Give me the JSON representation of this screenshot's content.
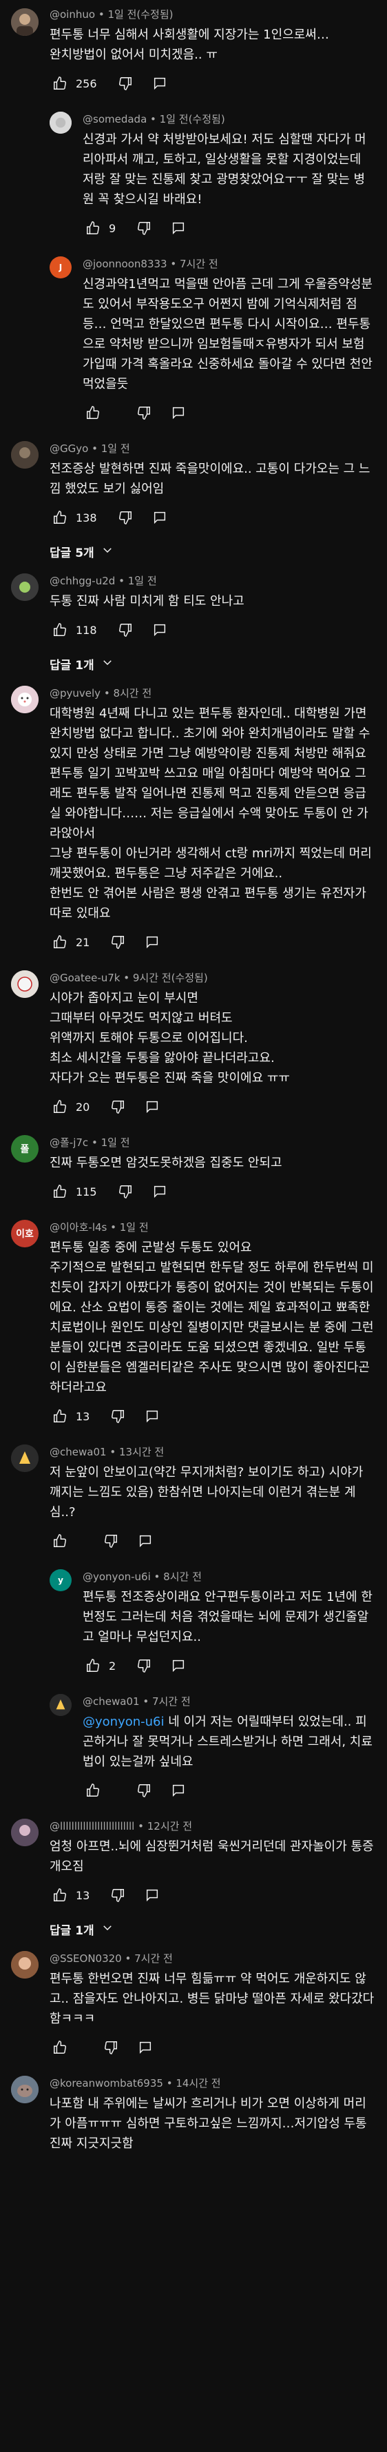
{
  "comments": [
    {
      "author": "@oinhuo",
      "time": "1일 전(수정됨)",
      "text": "편두통 너무 심해서 사회생활에 지장가는 1인으로써…\n완치방법이 없어서 미치겠음.. ㅠ",
      "likes": "256",
      "avatar": {
        "letter": "",
        "color": "#6b5b4f"
      }
    },
    {
      "author": "@somedada",
      "time": "1일 전(수정됨)",
      "text": "신경과 가서 약 처방받아보세요! 저도 심할땐 자다가 머리아파서 깨고, 토하고, 일상생활을 못할 지경이었는데 저랑 잘 맞는 진통제 찾고 광명찾았어요ㅜㅜ 잘 맞는 병원 꼭 찾으시길 바래요!",
      "likes": "9",
      "avatar": {
        "letter": "",
        "color": "#d9d9d9"
      }
    },
    {
      "author": "@joonnoon8333",
      "time": "7시간 전",
      "text": "신경과약1년먹고 먹을땐 안아픔 근데 그게 우울증약성분도 있어서 부작용도오구 어쩐지 밤에 기억식제처럼 점등… 언먹고 한달있으면 편두통 다시 시작이요… 편두통으로 약처방 받으니까 임보험들때ㅈ유병자가 되서 보험가입때 가격 혹올라요 신중하세요 돌아갈 수 있다면 천안먹었을듯",
      "likes": "",
      "avatar": {
        "letter": "J",
        "color": "#e0531f"
      }
    },
    {
      "author": "@GGyo",
      "time": "1일 전",
      "text": "전조증상 발현하면 진짜 죽을맛이에요.. 고통이 다가오는 그 느낌 했었도 보기 싫어임",
      "likes": "138",
      "avatar": {
        "letter": "",
        "color": "#4a3f36"
      }
    },
    {
      "author": "@chhgg-u2d",
      "time": "1일 전",
      "text": "두통 진짜 사람 미치게 함 티도 안나고",
      "likes": "118",
      "avatar": {
        "letter": "",
        "color": "#3a3a3a"
      }
    },
    {
      "author": "@pyuvely",
      "time": "8시간 전",
      "text": "대학병원 4년째 다니고 있는 편두통 환자인데.. 대학병원 가면 완치방법 없다고 합니다.. 초기에 와야 완치개념이라도 말할 수 있지 만성 상태로 가면 그냥 예방약이랑 진통제 처방만 해줘요\n편두통 일기 꼬박꼬박 쓰고요 매일 아침마다 예방약 먹어요 그래도 편두통 발작 일어나면 진통제 먹고 진통제 안듣으면 응급실 와야합니다…… 저는 응급실에서 수액 맞아도 두통이 안 가라앉아서\n그냥 편두통이 아닌거라 생각해서 ct랑 mri까지 찍었는데 머리 깨끗했어요. 편두통은 그냥 저주같은 거에요..\n한번도 안 겪어본 사람은 평생 안겪고 편두통 생기는 유전자가 따로 있대요",
      "likes": "21",
      "avatar": {
        "letter": "",
        "color": "#e8d0d8"
      }
    },
    {
      "author": "@Goatee-u7k",
      "time": "9시간 전(수정됨)",
      "text": "시야가 좁아지고 눈이 부시면\n그때부터 아무것도 먹지않고 버텨도\n위액까지 토해야 두통으로 이어집니다.\n최소 세시간을 두통을 앓아야 끝나더라고요.\n자다가 오는 편두통은 진짜 죽을 맛이에요 ㅠㅠ",
      "likes": "20",
      "avatar": {
        "letter": "",
        "color": "#e6e0da"
      }
    },
    {
      "author": "@폴-j7c",
      "time": "1일 전",
      "text": "진짜 두통오면 암것도못하겠음 집중도 안되고",
      "likes": "115",
      "avatar": {
        "letter": "폴",
        "color": "#2e7d32"
      }
    },
    {
      "author": "@이아호-l4s",
      "time": "1일 전",
      "text": "편두통 일종 중에 군발성 두통도 있어요\n주기적으로 발현되고 발현되면 한두달 정도 하루에 한두번씩 미친듯이 갑자기 아팠다가 통증이 없어지는 것이 반복되는 두통이에요. 산소 요법이 통증 줄이는 것에는 제일 효과적이고 뾰족한 치료법이나 원인도 미상인 질병이지만 댓글보시는 분 중에 그런 분들이 있다면 조금이라도 도움 되셨으면 좋겠네요. 일반 두통이 심한분들은 엠겔러티같은 주사도 맞으시면 많이 좋아진다곤 하더라고요",
      "likes": "13",
      "avatar": {
        "letter": "이호",
        "color": "#c0392b"
      }
    },
    {
      "author": "@chewa01",
      "time": "13시간 전",
      "text": "저 눈앞이 안보이고(약간 무지개처럼? 보이기도 하고) 시야가 깨지는 느낌도 있음) 한참쉬면 나아지는데 이런거 겪는분 계심..?",
      "likes": "",
      "avatar": {
        "letter": "",
        "color": "#2b2b2b"
      }
    },
    {
      "author": "@yonyon-u6i",
      "time": "8시간 전",
      "text": "편두통 전조증상이래요 안구편두통이라고 저도 1년에 한번정도 그러는데 처음 겪었을때는 뇌에 문제가 생긴줄알고 얼마나 무섭던지요..",
      "likes": "2",
      "avatar": {
        "letter": "y",
        "color": "#00897b"
      }
    },
    {
      "author": "@chewa01",
      "time": "7시간 전",
      "mention": "@yonyon-u6i",
      "text": " 네 이거 저는 어릴때부터 있었는데.. 피곤하거나 잘 못먹거나 스트레스받거나 하면 그래서, 치료법이 있는걸까 싶네요",
      "likes": "",
      "avatar": {
        "letter": "",
        "color": "#2b2b2b"
      }
    },
    {
      "author": "@llllllllllllllllllllllllll",
      "time": "12시간 전",
      "text": "엄청 아프면..뇌에 심장뛴거처럼 욱씬거리던데 관자놀이가 통증 개오짐",
      "likes": "13",
      "avatar": {
        "letter": "",
        "color": "#5a4b5e"
      }
    },
    {
      "author": "@SSEON0320",
      "time": "7시간 전",
      "text": "편두통 한번오면 진짜 너무 힘듦ㅠㅠ 약 먹어도 개운하지도 않고.. 잠을자도 안나아지고. 병든 닭마냥 떨아픈 자세로 왔다갔다함ㅋㅋㅋ",
      "likes": "",
      "avatar": {
        "letter": "",
        "color": "#8a5a3c"
      }
    },
    {
      "author": "@koreanwombat6935",
      "time": "14시간 전",
      "text": "나포함 내 주위에는 날씨가 흐리거나 비가 오면 이상하게 머리가 아픔ㅠㅠㅠ 심하면 구토하고싶은 느낌까지…저기압성 두통 진짜 지긋지긋함",
      "likes": "",
      "avatar": {
        "letter": "",
        "color": "#6b7a8a"
      }
    }
  ],
  "replies_buttons": [
    "답글 5개",
    "답글 1개",
    "답글 1개"
  ],
  "icons": {
    "like": "thumbs-up-icon",
    "dislike": "thumbs-down-icon",
    "reply": "comment-icon",
    "chevron": "chevron-down-icon"
  }
}
